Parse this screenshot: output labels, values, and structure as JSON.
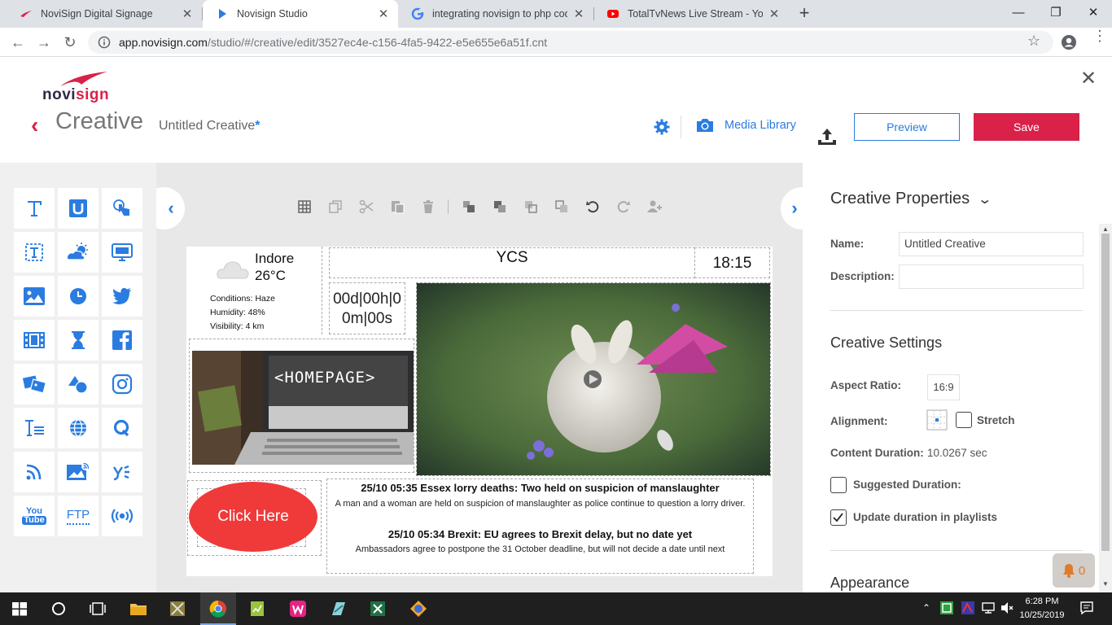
{
  "browser": {
    "tabs": [
      {
        "title": "NoviSign Digital Signage",
        "close": "✕"
      },
      {
        "title": "Novisign Studio",
        "close": "✕"
      },
      {
        "title": "integrating novisign to php code",
        "close": "✕"
      },
      {
        "title": "TotalTvNews Live Stream - YouTu",
        "close": "✕"
      }
    ],
    "new_tab": "+",
    "url_host": "app.novisign.com",
    "url_path": "/studio/#/creative/edit/3527ec4e-c156-4fa5-9422-e5e655e6a51f.cnt"
  },
  "header": {
    "logo_parts": [
      "novi",
      "sign"
    ],
    "section_title": "Creative",
    "creative_name": "Untitled Creative",
    "unsaved_marker": "*",
    "media_library_label": "Media Library",
    "preview_label": "Preview",
    "save_label": "Save",
    "close": "✕"
  },
  "palette": {
    "tools": [
      "text-icon",
      "ticker-icon",
      "touch-icon",
      "rss-text-icon",
      "weather-icon",
      "screen-icon",
      "image-icon",
      "clock-icon",
      "twitter-icon",
      "video-icon",
      "countdown-icon",
      "facebook-icon",
      "slideshow-icon",
      "shapes-icon",
      "instagram-icon",
      "text-list-icon",
      "web-icon",
      "q-icon",
      "rss-icon",
      "image-rss-icon",
      "yelp-icon",
      "youtube-icon",
      "ftp-icon",
      "broadcast-icon"
    ],
    "youtube_text": [
      "You",
      "Tube"
    ],
    "ftp_text": "FTP"
  },
  "stage": {
    "weather": {
      "city": "Indore",
      "temp": "26°C",
      "conditions": "Conditions: Haze",
      "humidity": "Humidity: 48%",
      "visibility": "Visibility: 4 km"
    },
    "title_text": "YCS",
    "clock_text": "18:15",
    "countdown_line1": "00d|00h|0",
    "countdown_line2": "0m|00s",
    "image_caption": "<HOMEPAGE>",
    "button_text": "Click Here",
    "news": [
      {
        "title": "25/10 05:35 Essex lorry deaths: Two held on suspicion of manslaughter",
        "body": "A man and a woman are held on suspicion of manslaughter as police continue to question a lorry driver."
      },
      {
        "title": "25/10 05:34 Brexit: EU agrees to Brexit delay, but no date yet",
        "body": "Ambassadors agree to postpone the 31 October deadline, but will not decide a date until next"
      }
    ]
  },
  "properties": {
    "title": "Creative Properties",
    "name_label": "Name:",
    "name_value": "Untitled Creative",
    "description_label": "Description:",
    "description_value": "",
    "settings_title": "Creative Settings",
    "aspect_label": "Aspect Ratio:",
    "aspect_value": "16:9",
    "alignment_label": "Alignment:",
    "stretch_label": "Stretch",
    "stretch_checked": false,
    "duration_label": "Content Duration:",
    "duration_value": "10.0267 sec",
    "suggested_label": "Suggested Duration:",
    "suggested_checked": false,
    "update_label": "Update duration in playlists",
    "update_checked": true,
    "appearance_title": "Appearance",
    "notifications_count": "0"
  },
  "taskbar": {
    "time": "6:28 PM",
    "date": "10/25/2019"
  },
  "colors": {
    "accent_blue": "#2a7ce0",
    "brand_red": "#d9214a",
    "button_red": "#f03a3a"
  }
}
